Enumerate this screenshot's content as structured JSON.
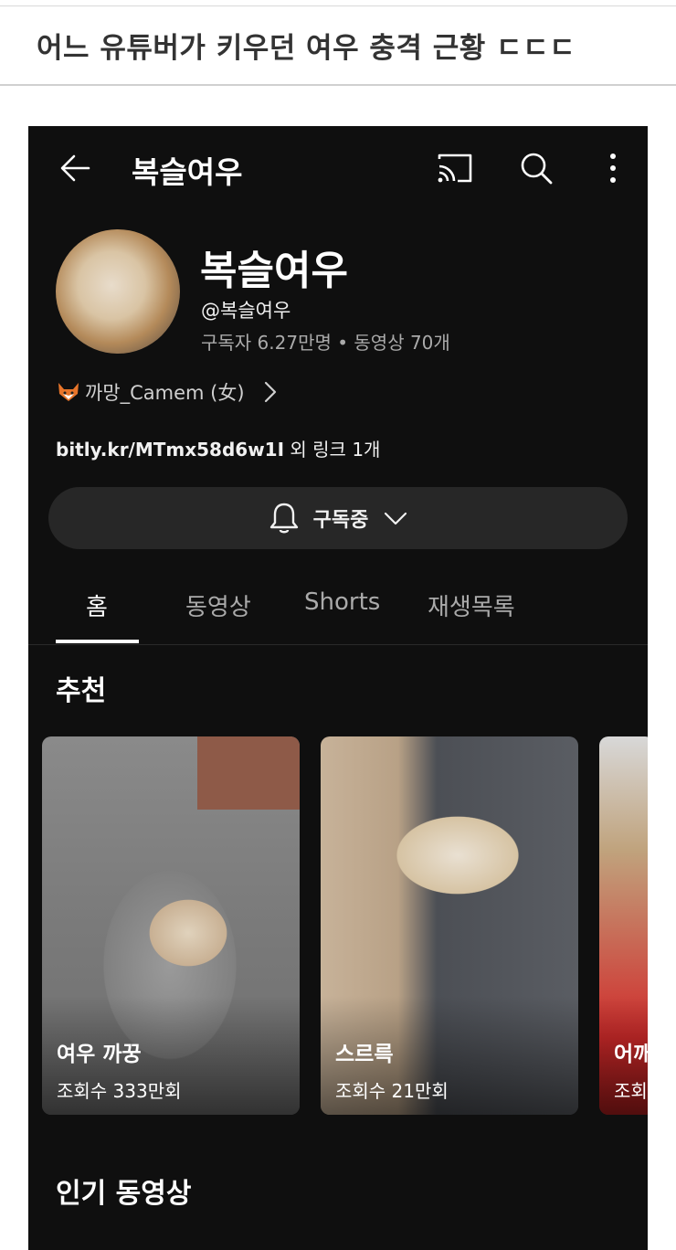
{
  "post": {
    "title": "어느 유튜버가 키우던 여우 충격 근황 ㄷㄷㄷ"
  },
  "appbar": {
    "title": "복슬여우"
  },
  "channel": {
    "name": "복슬여우",
    "handle": "@복슬여우",
    "stats": "구독자 6.27만명 • 동영상 70개",
    "description": "까망_Camem (女)",
    "link_url": "bitly.kr/MTmx58d6w1I",
    "link_suffix": " 외 링크 1개",
    "subscribe_label": "구독중"
  },
  "tabs": [
    {
      "label": "홈",
      "active": true
    },
    {
      "label": "동영상",
      "active": false
    },
    {
      "label": "Shorts",
      "active": false
    },
    {
      "label": "재생목록",
      "active": false
    }
  ],
  "sections": {
    "recommended": "추천",
    "popular": "인기 동영상"
  },
  "cards": [
    {
      "title": "여우 까꿍",
      "views": "조회수 333만회"
    },
    {
      "title": "스르륵",
      "views": "조회수 21만회"
    },
    {
      "title": "어깨",
      "views": "조회"
    }
  ],
  "icons": [
    "back-arrow-icon",
    "cast-icon",
    "search-icon",
    "more-vert-icon",
    "fox-emoji-icon",
    "chevron-right-icon",
    "bell-icon",
    "chevron-down-icon"
  ],
  "colors": {
    "background": "#0f0f0f",
    "button": "#272727",
    "muted_text": "#aaaaaa"
  }
}
